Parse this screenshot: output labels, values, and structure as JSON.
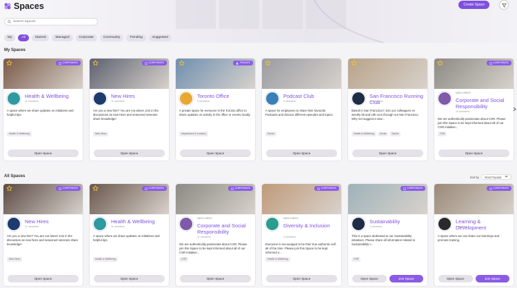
{
  "header": {
    "title": "Spaces",
    "create_label": "Create Space"
  },
  "search": {
    "placeholder": "Search Spaces"
  },
  "filters": [
    "My",
    "All",
    "Starred",
    "Managed",
    "Corporate",
    "Community",
    "Trending",
    "Suggested"
  ],
  "active_filter": "All",
  "sections": {
    "my_spaces": "My Spaces",
    "all_spaces": "All Spaces",
    "sort_label": "Sort by",
    "sort_value": "Most Popular"
  },
  "my_spaces": [
    {
      "name": "Health & Wellbeing",
      "kicker": "",
      "members": "11 members",
      "badge": "CORPORATE",
      "desc": "A space where we share updates on initiatives and helpful tips.",
      "tags": [
        "Health & Wellbeing"
      ],
      "starred": true,
      "img": "#7a5a48",
      "avatar": "#2f9aa0"
    },
    {
      "name": "New Hires",
      "kicker": "",
      "members": "11 members",
      "badge": "CORPORATE",
      "desc": "Are you a new hire? You are not alone! Join in the discussions as new hires and seasoned veterans share knowledge!",
      "tags": [
        "New Hires"
      ],
      "starred": true,
      "img": "#5d6170",
      "avatar": "#1d3b6e"
    },
    {
      "name": "Toronto Office",
      "kicker": "",
      "members": "5 members",
      "badge": "PRIVATE",
      "desc": "A private space for everyone in the Toronto office to share updates on activity in the office or events locally.",
      "tags": [
        "Department & Location"
      ],
      "starred": true,
      "img": "#6f8fb0",
      "avatar": "#e8a832"
    },
    {
      "name": "Podcast Club",
      "kicker": "",
      "members": "9 members",
      "badge": "",
      "desc": "A space for employees to share their favourite Podcasts and discuss different episodes and topics.",
      "tags": [
        "Social"
      ],
      "starred": true,
      "img": "#9a9ca2",
      "avatar": "#3a7fb8"
    },
    {
      "name": "San Francisco Running Club",
      "kicker": "",
      "members": "28 members",
      "badge": "",
      "desc": "Based in San Francisco? Join our colleagues on weekly 5k and 10k runs through out San Francisco. Why not suggest a new...",
      "tags": [
        "Health & Wellbeing",
        "Social",
        "Sports"
      ],
      "starred": true,
      "img": "#b8a38a",
      "avatar": "#1e2d45"
    },
    {
      "name": "Corporate and Social Responsibility",
      "kicker": "NEW HIRES",
      "members": "19 members",
      "badge": "CORPORATE",
      "desc": "We are authentically passionate about CSR. Please join this Space to be kept informed about all of our CSR initiative...",
      "tags": [
        "CSR"
      ],
      "starred": true,
      "img": "#8c8a84",
      "avatar": "#7f5aa8"
    }
  ],
  "all_spaces": [
    {
      "name": "New Hires",
      "kicker": "",
      "members": "11 members",
      "badge": "CORPORATE",
      "desc": "Are you a new hire? You are not alone! Join in the discussion as new hires and seasoned veterans share knowledge!",
      "tags": [
        "New Hires"
      ],
      "starred": true,
      "img": "#5b4a44",
      "avatar": "#1d3b6e",
      "buttons": [
        "Open Space"
      ]
    },
    {
      "name": "Health & Wellbeing",
      "kicker": "",
      "members": "11 members",
      "badge": "CORPORATE",
      "desc": "A space where we share updates on initiatives and helpful tips.",
      "tags": [
        "Health & Wellbeing"
      ],
      "starred": true,
      "img": "#6a574c",
      "avatar": "#2f9aa0",
      "buttons": [
        "Open Space"
      ]
    },
    {
      "name": "Corporate and Social Responsibility",
      "kicker": "NEW HIRES",
      "members": "11 members",
      "badge": "CORPORATE",
      "desc": "We are authentically passionate about CSR. Please join this Space to be kept informed about all of our CSR initiative...",
      "tags": [
        "CSR"
      ],
      "starred": false,
      "img": "#8c8a84",
      "avatar": "#7f5aa8",
      "buttons": [
        "Open Space"
      ]
    },
    {
      "name": "Diversity & Inclusion",
      "kicker": "NEW HIRES",
      "members": "3 members",
      "badge": "CORPORATE",
      "desc": "Everyone is encouraged to be their true authentic self, all of the time. Please join this Space to be kept informed o...",
      "tags": [
        "Health & Wellbeing"
      ],
      "starred": false,
      "img": "#c09a7a",
      "avatar": "#2a9d8f",
      "buttons": [
        "Open Space"
      ]
    },
    {
      "name": "Sustainability",
      "kicker": "",
      "members": "2 members",
      "badge": "CORPORATE",
      "desc": "This is a space dedicated to our Sustainability initiatives. Please share all information related to Sustainability t...",
      "tags": [
        "CSR"
      ],
      "starred": false,
      "img": "#9fb2b8",
      "avatar": "#1e2d45",
      "buttons": [
        "Open Space",
        "Join Space"
      ]
    },
    {
      "name": "Learning & Development",
      "kicker": "",
      "members": "1 member",
      "badge": "CORPORATE",
      "desc": "A space where we can share our learnings and promote training.",
      "tags": [],
      "starred": false,
      "img": "#9a8a78",
      "avatar": "#2a2a2a",
      "buttons": [
        "Open Space",
        "Join Space"
      ]
    }
  ]
}
